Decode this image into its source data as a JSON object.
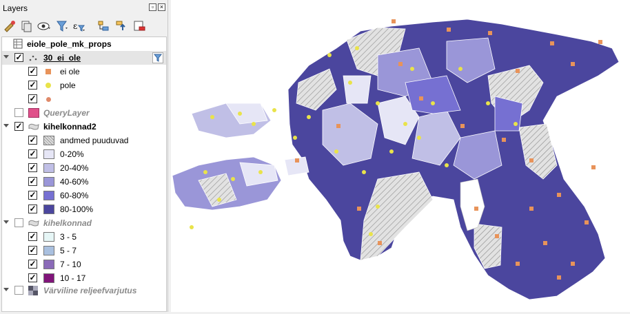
{
  "panel": {
    "title": "Layers"
  },
  "toolbar": {
    "icons": [
      "style-icon",
      "add-group-icon",
      "visibility-icon",
      "filter-icon",
      "expression-filter-icon",
      "expand-all-icon",
      "collapse-all-icon",
      "remove-layer-icon"
    ]
  },
  "layers": [
    {
      "label": "eiole_pole_mk_props"
    },
    {
      "label": "30_ei_ole"
    },
    {
      "label": "ei ole",
      "color": "#e8935a"
    },
    {
      "label": "pole",
      "color": "#e9e34a"
    },
    {
      "label": "",
      "color": "#e08a6a"
    },
    {
      "label": "QueryLayer",
      "color": "#e0508a"
    },
    {
      "label": "kihelkonnad2"
    },
    {
      "label": "andmed puuduvad"
    },
    {
      "label": "0-20%",
      "color": "#e6e6f6"
    },
    {
      "label": "20-40%",
      "color": "#c0bfe6"
    },
    {
      "label": "40-60%",
      "color": "#9a96d8"
    },
    {
      "label": "60-80%",
      "color": "#7670d2"
    },
    {
      "label": "80-100%",
      "color": "#4b469e"
    },
    {
      "label": "kihelkonnad"
    },
    {
      "label": "3 - 5",
      "color": "#e6f6f6"
    },
    {
      "label": "5 - 7",
      "color": "#a9c0df"
    },
    {
      "label": "7 - 10",
      "color": "#8a6ab8"
    },
    {
      "label": "10 - 17",
      "color": "#80147a"
    },
    {
      "label": "Värviline reljeefvarjutus"
    }
  ]
}
